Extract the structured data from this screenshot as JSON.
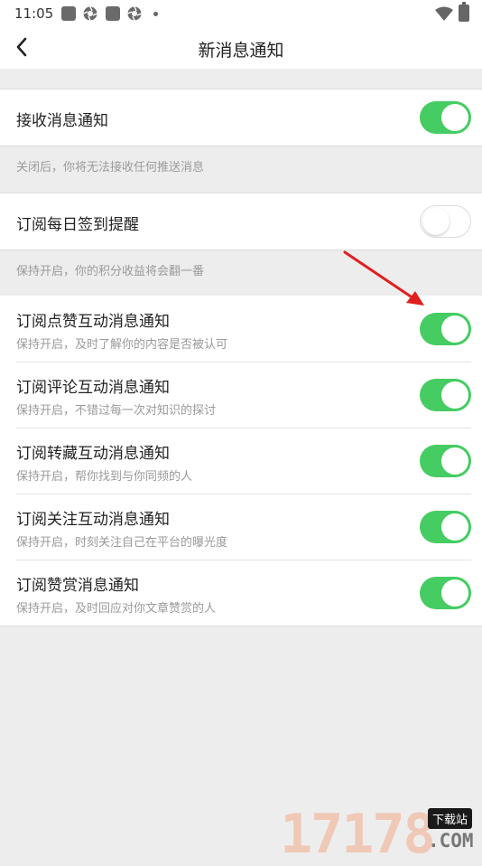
{
  "status_bar": {
    "time": "11:05"
  },
  "nav": {
    "title": "新消息通知"
  },
  "section_receive": {
    "title": "接收消息通知",
    "enabled": true,
    "hint": "关闭后，你将无法接收任何推送消息"
  },
  "section_checkin": {
    "title": "订阅每日签到提醒",
    "enabled": false,
    "hint": "保持开启，你的积分收益将会翻一番"
  },
  "subscriptions": [
    {
      "title": "订阅点赞互动消息通知",
      "subtitle": "保持开启，及时了解你的内容是否被认可",
      "enabled": true
    },
    {
      "title": "订阅评论互动消息通知",
      "subtitle": "保持开启，不错过每一次对知识的探讨",
      "enabled": true
    },
    {
      "title": "订阅转藏互动消息通知",
      "subtitle": "保持开启，帮你找到与你同频的人",
      "enabled": true
    },
    {
      "title": "订阅关注互动消息通知",
      "subtitle": "保持开启，时刻关注自己在平台的曝光度",
      "enabled": true
    },
    {
      "title": "订阅赞赏消息通知",
      "subtitle": "保持开启，及时回应对你文章赞赏的人",
      "enabled": true
    }
  ],
  "colors": {
    "toggle_on": "#45cc62",
    "annotation_arrow": "#e02020"
  },
  "watermark": {
    "number": "17178",
    "badge": "下载站",
    "domain": ".COM"
  }
}
